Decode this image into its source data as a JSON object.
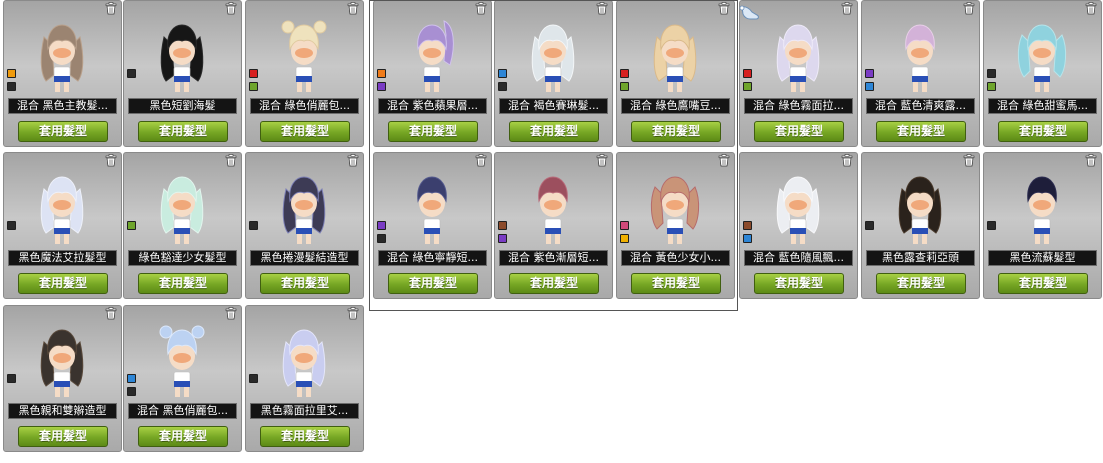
{
  "colors": {
    "skin": "#f5dcc6",
    "face_shade": "#ef9b66",
    "shirt": "#ffffff",
    "shorts": "#2a4fb6",
    "apply_green": "#76a624"
  },
  "icons": {
    "delete": "trash-icon",
    "cursor": "glove-cursor-icon"
  },
  "apply_label": "套用髮型",
  "hairstyles": [
    {
      "name": "混合 黑色主教髮...",
      "hair": "#9b8471",
      "hair_alt": "#b9a18c",
      "style": "long",
      "swatches": [
        "#ef9b0e",
        "#2a2a2a"
      ]
    },
    {
      "name": "黑色短劉海髮",
      "hair": "#161616",
      "hair_alt": "#2b2b2b",
      "style": "long",
      "swatches": [
        "#2a2a2a"
      ]
    },
    {
      "name": "混合 綠色俏麗包...",
      "hair": "#efe2bd",
      "hair_alt": "#e0caa0",
      "style": "buns",
      "swatches": [
        "#d61f1f",
        "#6fa52c"
      ]
    },
    {
      "name": "混合 紫色蘋果層...",
      "hair": "#a88fd2",
      "hair_alt": "#d0c2ec",
      "style": "pony",
      "swatches": [
        "#ef7b1a",
        "#7a3cc4"
      ]
    },
    {
      "name": "混合 褐色賽琳髮...",
      "hair": "#dfe6ea",
      "hair_alt": "#f3f6f8",
      "style": "long",
      "swatches": [
        "#2e86d6",
        "#2a2a2a"
      ]
    },
    {
      "name": "混合 綠色鷹嘴豆...",
      "hair": "#ecd2a6",
      "hair_alt": "#d9b98a",
      "style": "long",
      "swatches": [
        "#d61f1f",
        "#6fa52c"
      ]
    },
    {
      "name": "混合 綠色霧面拉...",
      "hair": "#ddd8ee",
      "hair_alt": "#eeeaf8",
      "style": "long",
      "swatches": [
        "#d61f1f",
        "#6fa52c"
      ]
    },
    {
      "name": "混合 藍色清爽露...",
      "hair": "#d3b2d8",
      "hair_alt": "#e8cfe8",
      "style": "short",
      "swatches": [
        "#7a3cc4",
        "#2e86d6"
      ]
    },
    {
      "name": "混合 綠色甜蜜馬...",
      "hair": "#8fd2de",
      "hair_alt": "#b7e4ea",
      "style": "twin",
      "swatches": [
        "#2a2a2a",
        "#6fa52c"
      ]
    },
    {
      "name": "黑色魔法艾拉髮型",
      "hair": "#dde3f4",
      "hair_alt": "#eef1fa",
      "style": "long",
      "swatches": [
        "#2a2a2a"
      ]
    },
    {
      "name": "綠色豁達少女髮型",
      "hair": "#c9ecdf",
      "hair_alt": "#e2f5ee",
      "style": "long",
      "swatches": [
        "#6fa52c"
      ]
    },
    {
      "name": "黑色捲漫髮結造型",
      "hair": "#3d3b55",
      "hair_alt": "#7c7fb5",
      "style": "long",
      "swatches": [
        "#2a2a2a"
      ]
    },
    {
      "name": "混合 綠色寧靜短...",
      "hair": "#3b3f6e",
      "hair_alt": "#545a8e",
      "style": "bob",
      "swatches": [
        "#7a3cc4",
        "#2a2a2a"
      ]
    },
    {
      "name": "混合 紫色漸層短...",
      "hair": "#9c4f5e",
      "hair_alt": "#b86b7a",
      "style": "bob",
      "swatches": [
        "#8b4a2a",
        "#7a3cc4"
      ]
    },
    {
      "name": "混合 黃色少女小...",
      "hair": "#c99478",
      "hair_alt": "#b66b6b",
      "style": "twin",
      "swatches": [
        "#d04a7a",
        "#f0b000"
      ]
    },
    {
      "name": "混合 藍色隨風飄...",
      "hair": "#eceef2",
      "hair_alt": "#f8f8fa",
      "style": "long",
      "swatches": [
        "#8b4a2a",
        "#2e86d6"
      ]
    },
    {
      "name": "黑色露查莉亞頭",
      "hair": "#2a221c",
      "hair_alt": "#4a3a2c",
      "style": "long",
      "swatches": [
        "#2a2a2a"
      ]
    },
    {
      "name": "黑色流蘇髮型",
      "hair": "#1e1e3a",
      "hair_alt": "#2e2e52",
      "style": "bob",
      "swatches": [
        "#2a2a2a"
      ]
    },
    {
      "name": "黑色親和雙辮造型",
      "hair": "#3a332e",
      "hair_alt": "#5a4a3c",
      "style": "long",
      "swatches": [
        "#2a2a2a"
      ]
    },
    {
      "name": "混合 黑色俏麗包...",
      "hair": "#bcd2f2",
      "hair_alt": "#dce8fa",
      "style": "buns",
      "swatches": [
        "#2e86d6",
        "#2a2a2a"
      ]
    },
    {
      "name": "黑色霧面拉里艾...",
      "hair": "#c9cdf0",
      "hair_alt": "#e4e6fa",
      "style": "long",
      "swatches": [
        "#2a2a2a"
      ]
    }
  ]
}
